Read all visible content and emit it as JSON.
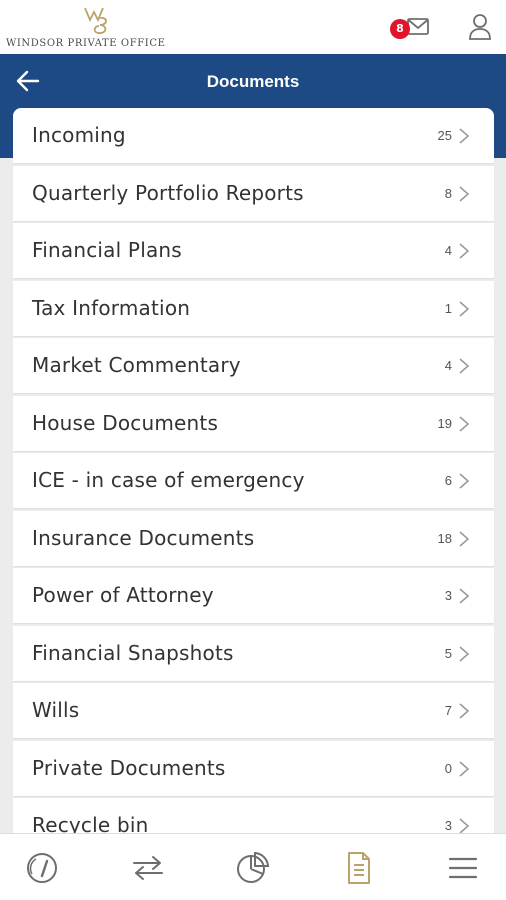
{
  "brand": {
    "name": "WINDSOR PRIVATE OFFICE",
    "logo_icon": "wpo-monogram-icon"
  },
  "topbar": {
    "mail_badge_count": "8",
    "mail_icon": "mail-icon",
    "user_icon": "user-icon"
  },
  "header": {
    "back_icon": "back-arrow-icon",
    "title": "Documents"
  },
  "documents": [
    {
      "label": "Incoming",
      "count": "25"
    },
    {
      "label": "Quarterly Portfolio Reports",
      "count": "8"
    },
    {
      "label": "Financial Plans",
      "count": "4"
    },
    {
      "label": "Tax Information",
      "count": "1"
    },
    {
      "label": "Market Commentary",
      "count": "4"
    },
    {
      "label": "House Documents",
      "count": "19"
    },
    {
      "label": "ICE - in case of emergency",
      "count": "6"
    },
    {
      "label": "Insurance Documents",
      "count": "18"
    },
    {
      "label": "Power of Attorney",
      "count": "3"
    },
    {
      "label": "Financial Snapshots",
      "count": "5"
    },
    {
      "label": "Wills",
      "count": "7"
    },
    {
      "label": "Private Documents",
      "count": "0"
    },
    {
      "label": "Recycle bin",
      "count": "3"
    }
  ],
  "bottom_nav": [
    {
      "icon": "dashboard-gauge-icon",
      "active": false
    },
    {
      "icon": "transfer-arrows-icon",
      "active": false
    },
    {
      "icon": "pie-chart-icon",
      "active": false
    },
    {
      "icon": "document-icon",
      "active": true
    },
    {
      "icon": "menu-icon",
      "active": false
    }
  ],
  "colors": {
    "header_blue": "#1d4a84",
    "badge_red": "#e0142a",
    "active_gold": "#b9a36a",
    "icon_gray": "#6e6e6e"
  }
}
